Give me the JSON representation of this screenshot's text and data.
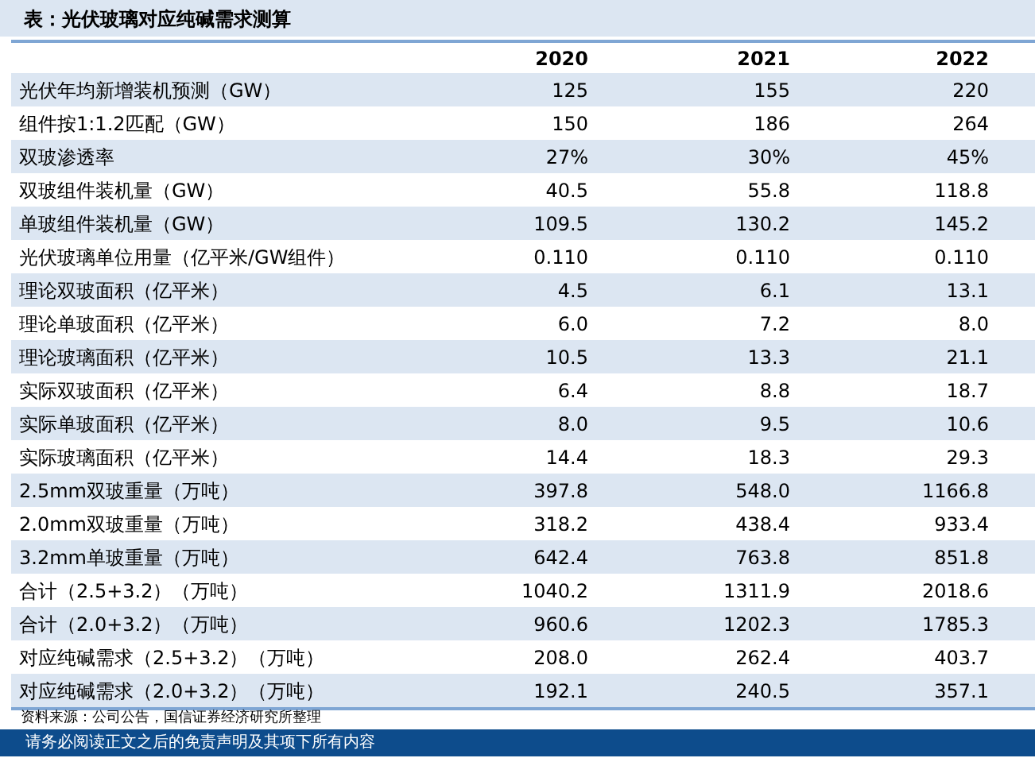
{
  "title": "表：光伏玻璃对应纯碱需求测算",
  "columns": [
    "2020",
    "2021",
    "2022"
  ],
  "rows": [
    {
      "label": "光伏年均新增装机预测（GW）",
      "values": [
        "125",
        "155",
        "220"
      ]
    },
    {
      "label": "组件按1:1.2匹配（GW）",
      "values": [
        "150",
        "186",
        "264"
      ]
    },
    {
      "label": "双玻渗透率",
      "values": [
        "27%",
        "30%",
        "45%"
      ]
    },
    {
      "label": "双玻组件装机量（GW）",
      "values": [
        "40.5",
        "55.8",
        "118.8"
      ]
    },
    {
      "label": "单玻组件装机量（GW）",
      "values": [
        "109.5",
        "130.2",
        "145.2"
      ]
    },
    {
      "label": "光伏玻璃单位用量（亿平米/GW组件）",
      "values": [
        "0.110",
        "0.110",
        "0.110"
      ]
    },
    {
      "label": "理论双玻面积（亿平米）",
      "values": [
        "4.5",
        "6.1",
        "13.1"
      ]
    },
    {
      "label": "理论单玻面积（亿平米）",
      "values": [
        "6.0",
        "7.2",
        "8.0"
      ]
    },
    {
      "label": "理论玻璃面积（亿平米）",
      "values": [
        "10.5",
        "13.3",
        "21.1"
      ]
    },
    {
      "label": "实际双玻面积（亿平米）",
      "values": [
        "6.4",
        "8.8",
        "18.7"
      ]
    },
    {
      "label": "实际单玻面积（亿平米）",
      "values": [
        "8.0",
        "9.5",
        "10.6"
      ]
    },
    {
      "label": "实际玻璃面积（亿平米）",
      "values": [
        "14.4",
        "18.3",
        "29.3"
      ]
    },
    {
      "label": "2.5mm双玻重量（万吨）",
      "values": [
        "397.8",
        "548.0",
        "1166.8"
      ]
    },
    {
      "label": "2.0mm双玻重量（万吨）",
      "values": [
        "318.2",
        "438.4",
        "933.4"
      ]
    },
    {
      "label": "3.2mm单玻重量（万吨）",
      "values": [
        "642.4",
        "763.8",
        "851.8"
      ]
    },
    {
      "label": "合计（2.5+3.2）（万吨）",
      "values": [
        "1040.2",
        "1311.9",
        "2018.6"
      ]
    },
    {
      "label": "合计（2.0+3.2）（万吨）",
      "values": [
        "960.6",
        "1202.3",
        "1785.3"
      ]
    },
    {
      "label": "对应纯碱需求（2.5+3.2）（万吨）",
      "values": [
        "208.0",
        "262.4",
        "403.7"
      ]
    },
    {
      "label": "对应纯碱需求（2.0+3.2）（万吨）",
      "values": [
        "192.1",
        "240.5",
        "357.1"
      ]
    }
  ],
  "source": "资料来源：公司公告，国信证券经济研究所整理",
  "disclaimer": "请务必阅读正文之后的免责声明及其项下所有内容"
}
